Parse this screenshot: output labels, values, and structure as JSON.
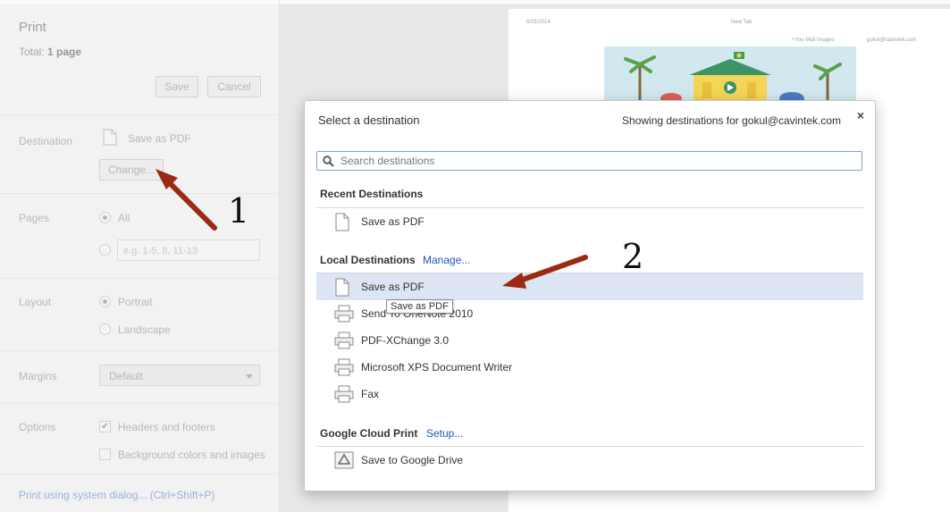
{
  "panel": {
    "title": "Print",
    "total_prefix": "Total: ",
    "total_value": "1 page",
    "save_label": "Save",
    "cancel_label": "Cancel",
    "destination_label": "Destination",
    "destination_value": "Save as PDF",
    "change_label": "Change...",
    "pages_label": "Pages",
    "pages_all": "All",
    "pages_placeholder": "e.g. 1-5, 8, 11-13",
    "layout_label": "Layout",
    "layout_portrait": "Portrait",
    "layout_landscape": "Landscape",
    "margins_label": "Margins",
    "margins_value": "Default",
    "options_label": "Options",
    "opt_headers": "Headers and footers",
    "opt_background": "Background colors and images",
    "system_dialog": "Print using system dialog... (Ctrl+Shift+P)"
  },
  "preview": {
    "date": "6/25/2014",
    "tab": "New Tab",
    "links": "+You   Mail   Images",
    "account": "gokul@cavintek.com"
  },
  "dialog": {
    "title": "Select a destination",
    "account": "Showing destinations for gokul@cavintek.com",
    "close": "×",
    "search_placeholder": "Search destinations",
    "recent_header": "Recent Destinations",
    "recent": [
      {
        "label": "Save as PDF"
      }
    ],
    "local_header": "Local Destinations",
    "local_manage": "Manage...",
    "local": [
      {
        "label": "Save as PDF"
      },
      {
        "label": "Send To OneNote 2010"
      },
      {
        "label": "PDF-XChange 3.0"
      },
      {
        "label": "Microsoft XPS Document Writer"
      },
      {
        "label": "Fax"
      }
    ],
    "cloud_header": "Google Cloud Print",
    "cloud_setup": "Setup...",
    "cloud": [
      {
        "label": "Save to Google Drive"
      }
    ],
    "tooltip": "Save as PDF"
  },
  "callouts": {
    "one": "1",
    "two": "2"
  },
  "colors": {
    "arrow": "#9b2a12",
    "link": "#2356b8",
    "selected_row": "#dbe5f3"
  }
}
